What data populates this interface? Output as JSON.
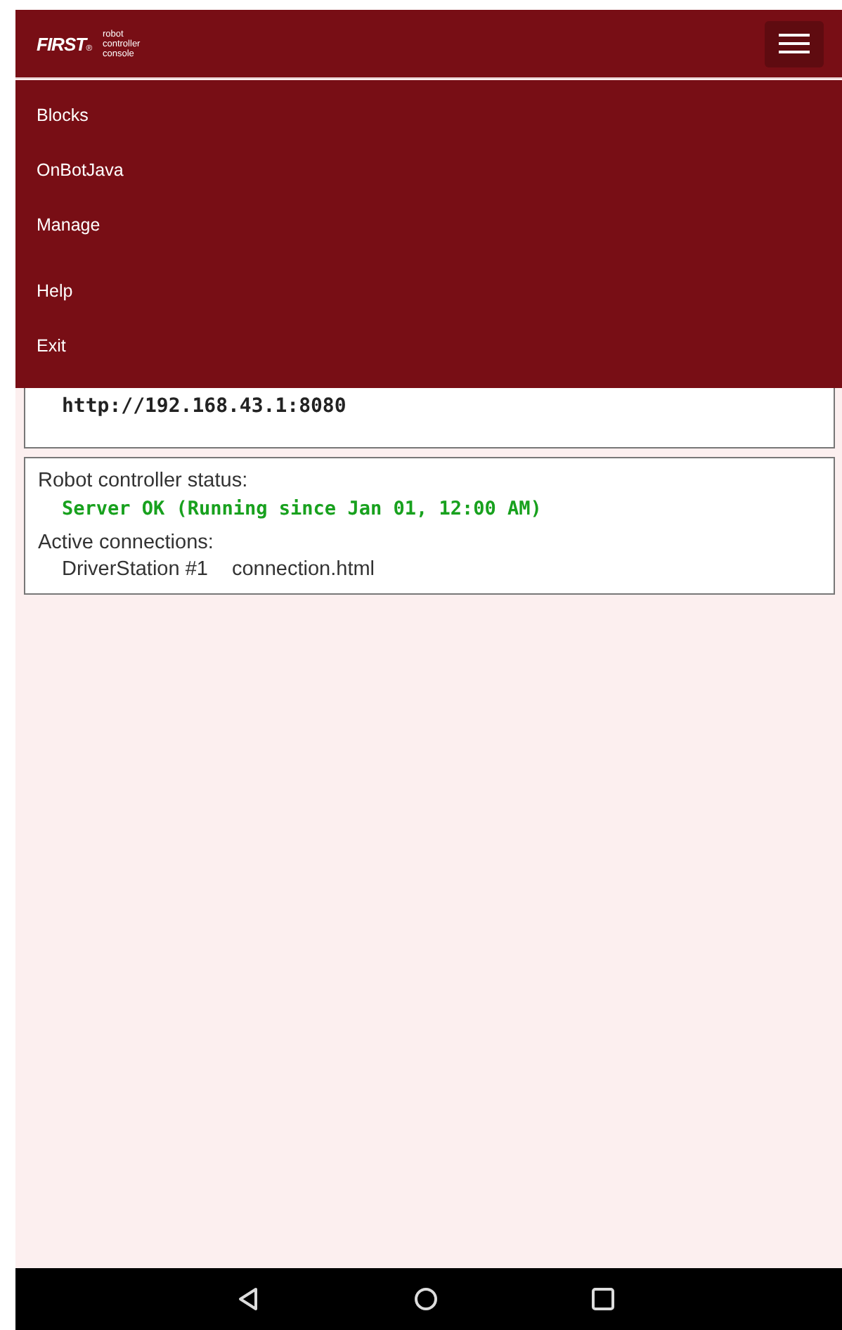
{
  "header": {
    "logo": "FIRST",
    "logo_mark": "®",
    "subtitle": [
      "robot",
      "controller",
      "console"
    ]
  },
  "menu": {
    "expanded": true,
    "items": [
      {
        "label": "Blocks"
      },
      {
        "label": "OnBotJava"
      },
      {
        "label": "Manage"
      },
      {
        "label": "Help"
      },
      {
        "label": "Exit"
      }
    ]
  },
  "address_card": {
    "url": "http://192.168.43.1:8080"
  },
  "status_card": {
    "status_label": "Robot controller status:",
    "status": "Server OK (Running since Jan 01, 12:00 AM)",
    "connections_label": "Active connections:",
    "connections": [
      {
        "name": "DriverStation #1",
        "page": "connection.html"
      }
    ]
  }
}
